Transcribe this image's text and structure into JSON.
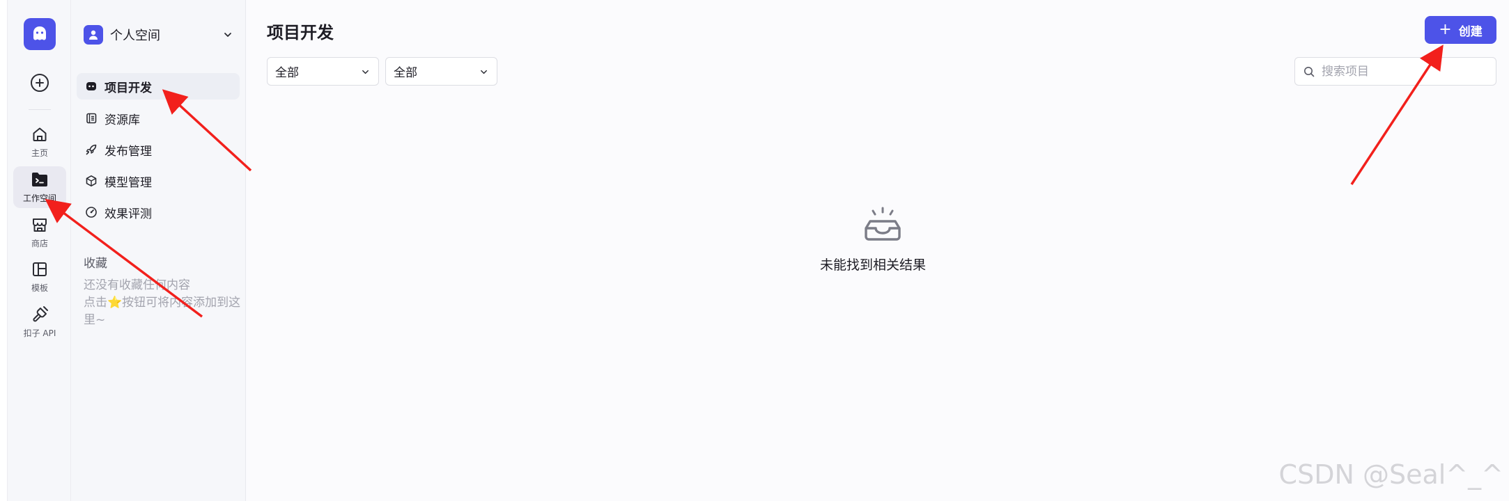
{
  "rail": {
    "items": [
      {
        "label": "主页",
        "icon": "home-icon"
      },
      {
        "label": "工作空间",
        "icon": "workspace-icon"
      },
      {
        "label": "商店",
        "icon": "store-icon"
      },
      {
        "label": "模板",
        "icon": "template-icon"
      },
      {
        "label": "扣子 API",
        "icon": "api-icon"
      }
    ]
  },
  "sidebar": {
    "space_name": "个人空间",
    "nav": [
      {
        "label": "项目开发",
        "icon": "project-dev-icon"
      },
      {
        "label": "资源库",
        "icon": "library-icon"
      },
      {
        "label": "发布管理",
        "icon": "rocket-icon"
      },
      {
        "label": "模型管理",
        "icon": "cube-icon"
      },
      {
        "label": "效果评测",
        "icon": "gauge-icon"
      }
    ],
    "favorites_title": "收藏",
    "favorites_empty_line1": "还没有收藏任何内容",
    "favorites_empty_line2_prefix": "点击",
    "favorites_empty_line2_suffix": "按钮可将内容添加到这里~"
  },
  "main": {
    "title": "项目开发",
    "create_label": "创建",
    "filter1": "全部",
    "filter2": "全部",
    "search_placeholder": "搜索项目",
    "empty_text": "未能找到相关结果"
  },
  "watermark": "CSDN @Seal^_^",
  "colors": {
    "accent": "#4d53e8",
    "annotation_arrow": "#f2201c"
  }
}
